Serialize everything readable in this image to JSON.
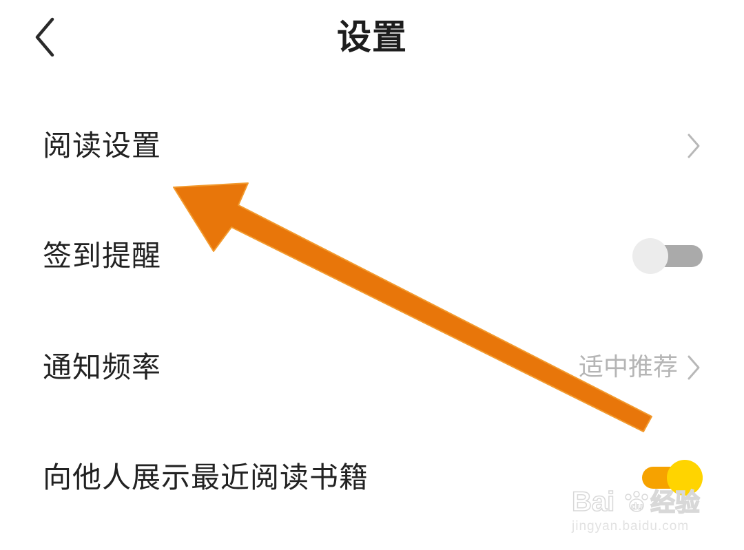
{
  "header": {
    "title": "设置",
    "back_icon": "chevron-left-icon"
  },
  "rows": [
    {
      "label": "阅读设置",
      "type": "link",
      "icon": "chevron-right-icon"
    },
    {
      "label": "签到提醒",
      "type": "toggle",
      "state": "off"
    },
    {
      "label": "通知频率",
      "type": "link",
      "value": "适中推荐",
      "icon": "chevron-right-icon"
    },
    {
      "label": "向他人展示最近阅读书籍",
      "type": "toggle",
      "state": "on"
    }
  ],
  "colors": {
    "toggle_on_track": "#f6a200",
    "toggle_on_knob": "#ffd400",
    "toggle_off_track": "#aaaaaa",
    "toggle_off_knob": "#ececec",
    "annotation_arrow": "#e8760a",
    "secondary_text": "#b5b5b5"
  },
  "watermark": {
    "logo_text": "Baidu经验",
    "url": "jingyan.baidu.com"
  }
}
